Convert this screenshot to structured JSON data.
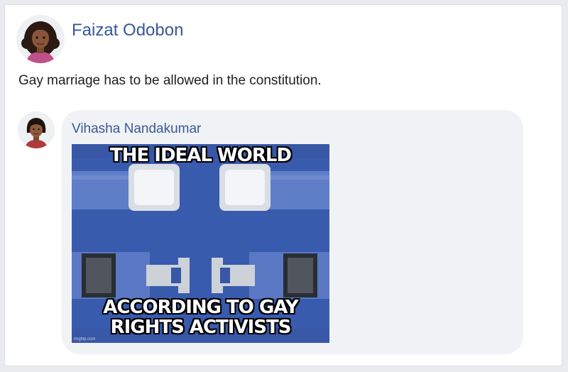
{
  "post": {
    "author": "Faizat Odobon",
    "text": "Gay marriage has to be allowed in the constitution."
  },
  "comment": {
    "author": "Vihasha Nandakumar",
    "meme": {
      "top_caption": "THE IDEAL WORLD",
      "bottom_caption_line1": "ACCORDING TO GAY",
      "bottom_caption_line2": "RIGHTS ACTIVISTS",
      "watermark": "imgflip.com"
    }
  },
  "colors": {
    "link": "#385898",
    "bubble": "#f0f2f5",
    "meme_background": "#3857a7"
  }
}
